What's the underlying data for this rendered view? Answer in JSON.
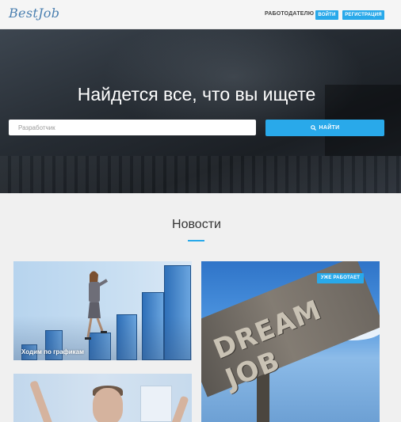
{
  "header": {
    "logo": "BestJob",
    "employer_menu": "РАБОТОДАТЕЛЮ",
    "login_label": "ВОЙТИ",
    "register_label": "РЕГИСТРАЦИЯ"
  },
  "hero": {
    "title": "Найдется все, что вы ищете",
    "search_placeholder": "Разработчик",
    "search_button": "НАЙТИ"
  },
  "news": {
    "title": "Новости",
    "cards": [
      {
        "caption": "Ходим по графикам"
      },
      {
        "badge": "УЖЕ РАБОТАЕТ",
        "image_text": "DREAM JOB"
      },
      {
        "caption": ""
      }
    ]
  },
  "colors": {
    "accent": "#29a9ea",
    "page_bg": "#f0f0f0",
    "logo": "#4a7fb0"
  },
  "icons": {
    "search_button_icon": "search-icon",
    "employer_dropdown_icon": "chevron-down-icon"
  }
}
